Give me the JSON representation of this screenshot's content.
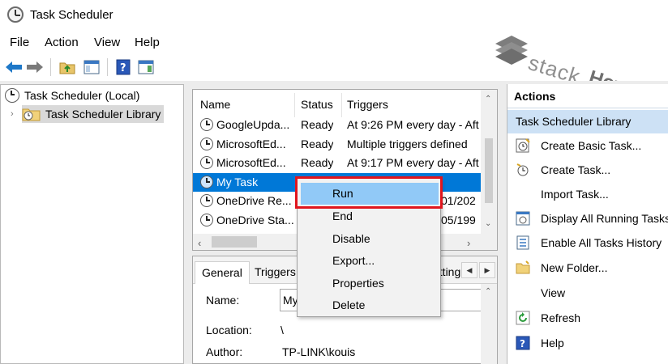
{
  "window": {
    "title": "Task Scheduler"
  },
  "menu": {
    "items": [
      "File",
      "Action",
      "View",
      "Help"
    ]
  },
  "toolbar": {
    "icons": [
      "arrow-back-icon",
      "arrow-forward-icon",
      "folder-up-icon",
      "show-hide-console-tree-icon",
      "help-icon",
      "show-hide-action-pane-icon"
    ]
  },
  "watermark": {
    "text1": "stack",
    "text2": "HowTo"
  },
  "tree": {
    "root": "Task Scheduler (Local)",
    "library": "Task Scheduler Library"
  },
  "task_list": {
    "columns": [
      "Name",
      "Status",
      "Triggers"
    ],
    "rows": [
      {
        "name": "GoogleUpda...",
        "status": "Ready",
        "triggers": "At 9:26 PM every day - Aft"
      },
      {
        "name": "MicrosoftEd...",
        "status": "Ready",
        "triggers": "Multiple triggers defined"
      },
      {
        "name": "MicrosoftEd...",
        "status": "Ready",
        "triggers": "At 9:17 PM every day - Aft"
      },
      {
        "name": "My Task",
        "status": "",
        "triggers": ""
      },
      {
        "name": "OneDrive Re...",
        "status": "",
        "triggers": "01/202"
      },
      {
        "name": "OneDrive Sta...",
        "status": "",
        "triggers": "05/199"
      }
    ]
  },
  "context_menu": {
    "items": [
      "Run",
      "End",
      "Disable",
      "Export...",
      "Properties",
      "Delete"
    ]
  },
  "details": {
    "tabs": [
      "General",
      "Triggers",
      "etting"
    ],
    "name_label": "Name:",
    "name_value": "My",
    "location_label": "Location:",
    "location_value": "\\",
    "author_label": "Author:",
    "author_value": "TP-LINK\\kouis"
  },
  "actions": {
    "header": "Actions",
    "section": "Task Scheduler Library",
    "items": [
      {
        "label": "Create Basic Task...",
        "icon": "create-basic-task-icon"
      },
      {
        "label": "Create Task...",
        "icon": "create-task-icon"
      },
      {
        "label": "Import Task...",
        "icon": ""
      },
      {
        "label": "Display All Running Tasks",
        "icon": "running-tasks-icon"
      },
      {
        "label": "Enable All Tasks History",
        "icon": "tasks-history-icon"
      },
      {
        "label": "New Folder...",
        "icon": "new-folder-icon"
      },
      {
        "label": "View",
        "icon": ""
      },
      {
        "label": "Refresh",
        "icon": "refresh-icon"
      },
      {
        "label": "Help",
        "icon": "help-icon"
      }
    ]
  }
}
